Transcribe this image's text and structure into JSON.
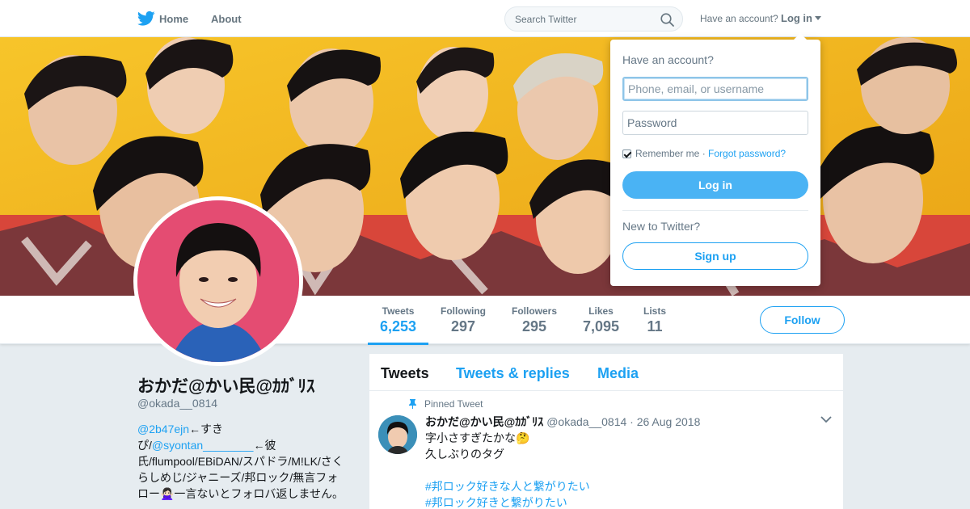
{
  "nav": {
    "home_label": "Home",
    "about_label": "About",
    "search_placeholder": "Search Twitter",
    "have_account": "Have an account?",
    "login_label": "Log in"
  },
  "profile": {
    "name": "おかだ@かい民@ｶｶﾞﾘｽ",
    "handle": "@okada__0814",
    "bio": {
      "mention1": "@2b47ejn",
      "text1": "←すきぴ/",
      "mention2": "@syontan________",
      "text2": "←彼氏/flumpool/EBiDAN/スパドラ/M!LK/さくらしめじ/ジャニーズ/邦ロック/無言フォロー🙅🏻‍♀️一言ないとフォロバ返しません。"
    }
  },
  "stats": [
    {
      "label": "Tweets",
      "value": "6,253"
    },
    {
      "label": "Following",
      "value": "297"
    },
    {
      "label": "Followers",
      "value": "295"
    },
    {
      "label": "Likes",
      "value": "7,095"
    },
    {
      "label": "Lists",
      "value": "11"
    }
  ],
  "follow_label": "Follow",
  "timeline": {
    "tabs": [
      "Tweets",
      "Tweets & replies",
      "Media"
    ],
    "pinned_label": "Pinned Tweet",
    "tweet": {
      "name": "おかだ@かい民@ｶｶﾞﾘｽ",
      "handle": "@okada__0814",
      "date": "· 26 Aug 2018",
      "line1": "字小さすぎたかな🤔",
      "line2": "久しぶりのタグ",
      "tag1": "#邦ロック好きな人と繋がりたい",
      "tag2": "#邦ロック好きと繋がりたい"
    }
  },
  "login_dropdown": {
    "title": "Have an account?",
    "username_placeholder": "Phone, email, or username",
    "password_placeholder": "Password",
    "remember_label": "Remember me",
    "separator": " · ",
    "forgot_label": "Forgot password?",
    "login_button": "Log in",
    "new_label": "New to Twitter?",
    "signup_button": "Sign up"
  },
  "colors": {
    "brand": "#1da1f2",
    "banner": "#f1b41b",
    "avatar_bg": "#e44c72"
  }
}
